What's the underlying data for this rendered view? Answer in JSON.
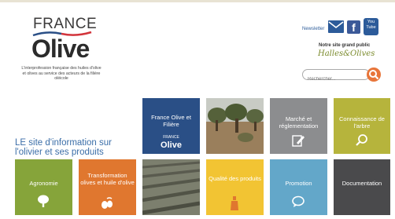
{
  "logo": {
    "france": "FRANCE",
    "olive": "Olive",
    "tagline": "L'interprofession française des huiles d'olive et olives au service des acteurs de la filière oléicole"
  },
  "header": {
    "newsletter": "Newsletter",
    "facebook_glyph": "f",
    "youtube_label": "You Tube",
    "site_label": "Notre site grand public",
    "halles_label": "Halles&Olives",
    "search_placeholder": "Rechercher..."
  },
  "headline": "LE site d'information sur l'olivier et ses produits",
  "tiles": [
    {
      "label": "France Olive et Filière",
      "sublabel_france": "FRANCE",
      "sublabel_olive": "Olive",
      "color": "#2a4f86"
    },
    {
      "label": "Marché et réglementation",
      "color": "#8c8d8f"
    },
    {
      "label": "Connaissance de l'arbre",
      "color": "#b6b43c"
    },
    {
      "label": "Agronomie",
      "color": "#86a43a"
    },
    {
      "label": "Transformation olives et huile d'olive",
      "color": "#e0772f"
    },
    {
      "label": "Qualité des produits",
      "color": "#f2c433"
    },
    {
      "label": "Promotion",
      "color": "#63a7c9"
    },
    {
      "label": "Documentation",
      "color": "#4a4a4c"
    }
  ],
  "icons": [
    "mail-icon",
    "facebook-icon",
    "youtube-icon",
    "search-icon",
    "tree-icon",
    "olive-icon",
    "bottle-icon",
    "chat-icon",
    "pencil-icon",
    "magnifier-icon"
  ]
}
